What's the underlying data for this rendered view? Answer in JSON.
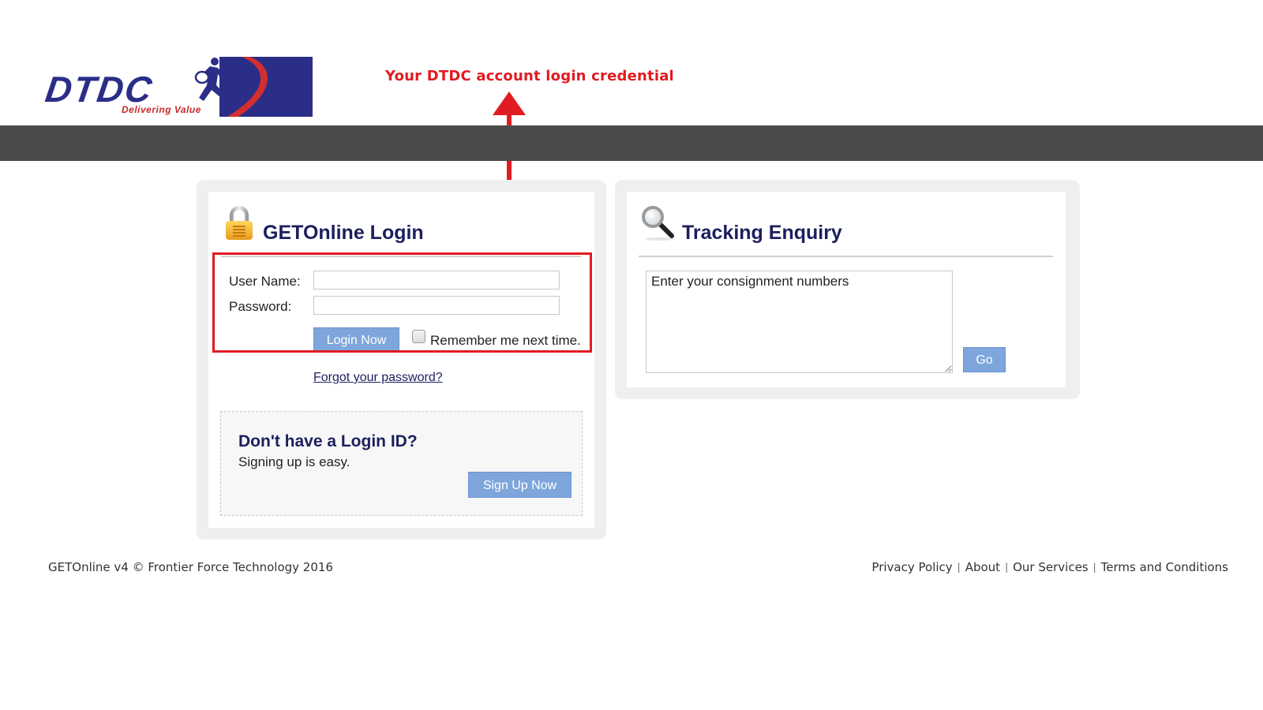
{
  "header": {
    "logo": {
      "brand": "DTDC",
      "tagline": "Delivering Value"
    },
    "annotation": "Your DTDC account login credential",
    "colors": {
      "brand_blue": "#2a2e87",
      "annotation_red": "#e11b22",
      "topbar": "#4a4a4a"
    }
  },
  "login_panel": {
    "title": "GETOnline Login",
    "icon": "padlock-icon",
    "username_label": "User Name:",
    "username_value": "",
    "password_label": "Password:",
    "password_value": "",
    "login_button": "Login Now",
    "remember_label": "Remember me next time.",
    "remember_checked": false,
    "forgot_link": "Forgot your password?",
    "signup": {
      "title": "Don't have a Login ID?",
      "subtitle": "Signing up is easy.",
      "button": "Sign Up Now"
    }
  },
  "tracking_panel": {
    "title": "Tracking Enquiry",
    "icon": "magnifier-icon",
    "textarea_value": "Enter your consignment numbers",
    "go_button": "Go"
  },
  "footer": {
    "copyright": "GETOnline v4 © Frontier Force Technology 2016",
    "links": [
      "Privacy Policy",
      "About",
      "Our Services",
      "Terms and Conditions"
    ],
    "separator": "|"
  },
  "colors": {
    "button_bg": "#7ea6dd",
    "title_navy": "#1b1f5e"
  }
}
